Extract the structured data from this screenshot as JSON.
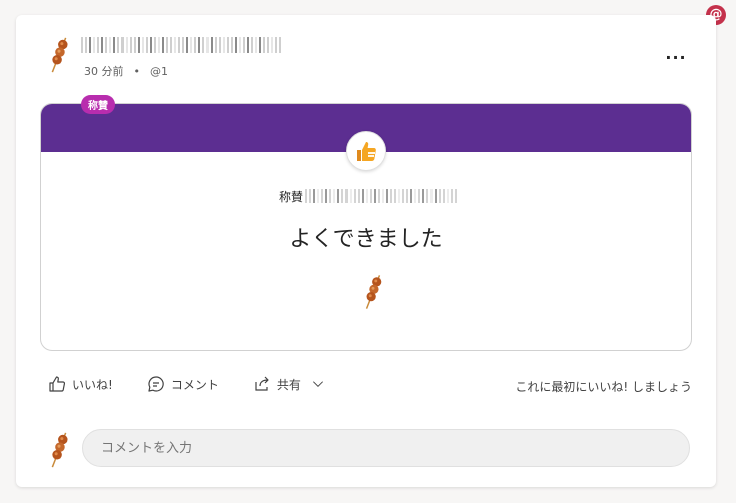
{
  "header": {
    "time": "30 分前",
    "separator": "•",
    "mention_count": "@1",
    "more_label": "..."
  },
  "mention_badge": {
    "label": "@"
  },
  "praise": {
    "tag": "称賛",
    "recipient_prefix": "称賛",
    "message": "よくできました",
    "badge_icon": "thumbs-up-icon",
    "banner_color": "#5c2e91",
    "tag_color": "#b82dae"
  },
  "actions": {
    "like": "いいね!",
    "comment": "コメント",
    "share": "共有",
    "like_prompt": "これに最初にいいね! しましょう"
  },
  "comment": {
    "placeholder": "コメントを入力"
  },
  "colors": {
    "accent_purple": "#5c2e91",
    "mention_red": "#c4314b"
  }
}
